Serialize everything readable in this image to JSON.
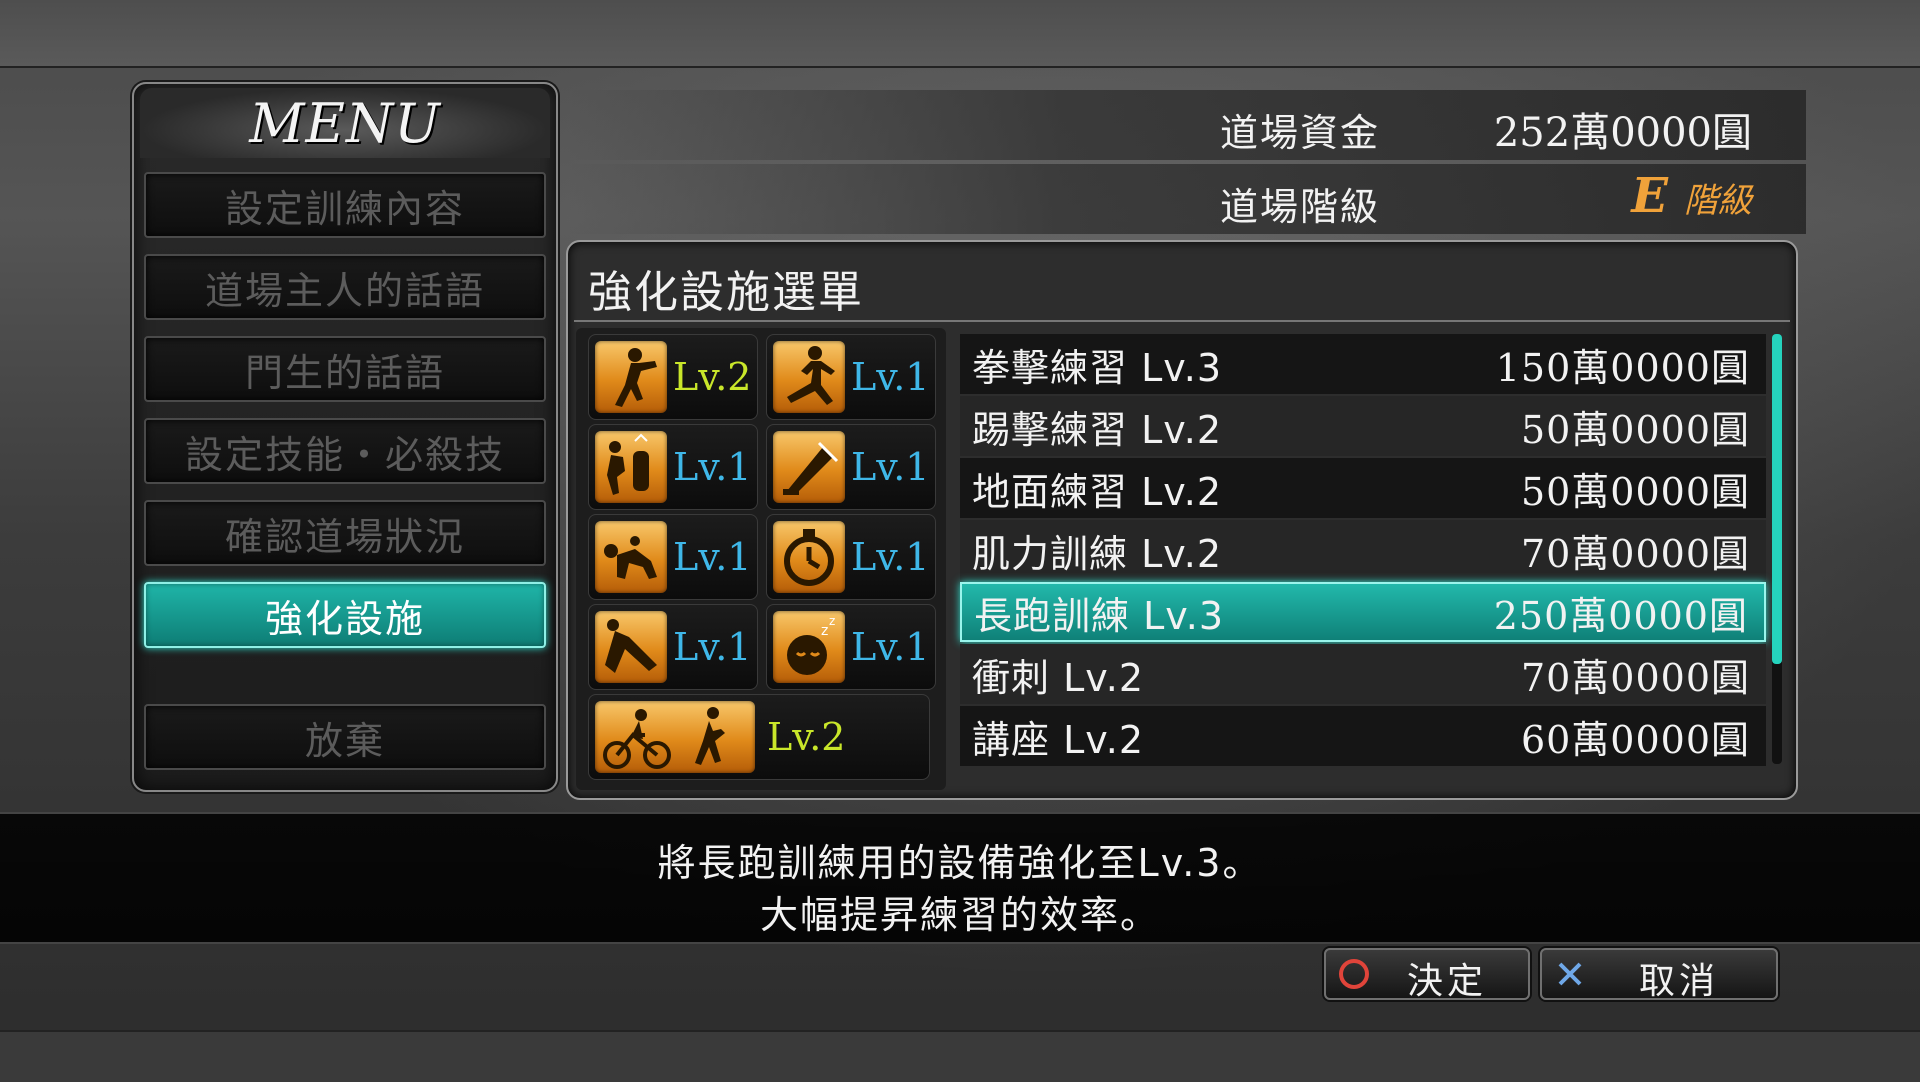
{
  "menu": {
    "title": "MENU",
    "items": [
      {
        "label": "設定訓練內容",
        "active": false
      },
      {
        "label": "道場主人的話語",
        "active": false
      },
      {
        "label": "門生的話語",
        "active": false
      },
      {
        "label": "設定技能・必殺技",
        "active": false
      },
      {
        "label": "確認道場狀況",
        "active": false
      },
      {
        "label": "強化設施",
        "active": true
      },
      {
        "label": "放棄",
        "active": false
      }
    ]
  },
  "dojo": {
    "funds_label": "道場資金",
    "funds_value": "252萬0000圓",
    "rank_label": "道場階級",
    "rank_letter": "E",
    "rank_word": "階級"
  },
  "panel": {
    "title": "強化設施選單"
  },
  "facility_icons": [
    {
      "icon": "punch-icon",
      "level": "Lv.2"
    },
    {
      "icon": "kick-icon",
      "level": "Lv.1"
    },
    {
      "icon": "ground-grapple-icon",
      "level": "Lv.1"
    },
    {
      "icon": "strength-training-icon",
      "level": "Lv.1"
    },
    {
      "icon": "tackle-icon",
      "level": "Lv.1"
    },
    {
      "icon": "stopwatch-icon",
      "level": "Lv.1"
    },
    {
      "icon": "stretch-icon",
      "level": "Lv.1"
    },
    {
      "icon": "sleep-icon",
      "level": "Lv.1"
    },
    {
      "icon": "bike-run-icon",
      "level": "Lv.2"
    }
  ],
  "upgrades": [
    {
      "name": "拳擊練習 Lv.3",
      "price": "150萬0000圓"
    },
    {
      "name": "踢擊練習 Lv.2",
      "price": "50萬0000圓"
    },
    {
      "name": "地面練習 Lv.2",
      "price": "50萬0000圓"
    },
    {
      "name": "肌力訓練 Lv.2",
      "price": "70萬0000圓"
    },
    {
      "name": "長跑訓練 Lv.3",
      "price": "250萬0000圓"
    },
    {
      "name": "衝刺 Lv.2",
      "price": "70萬0000圓"
    },
    {
      "name": "講座 Lv.2",
      "price": "60萬0000圓"
    }
  ],
  "selected_upgrade": 4,
  "description": {
    "line1": "將長跑訓練用的設備強化至Lv.3。",
    "line2": "大幅提昇練習的效率。"
  },
  "buttons": {
    "confirm": "決定",
    "cancel": "取消"
  },
  "colors": {
    "accent_teal": "#1fb5a8",
    "level_blue": "#3fb7e8",
    "level_green": "#c9e62a",
    "rank_orange": "#f0a23a",
    "icon_orange": "#e08a1a"
  }
}
